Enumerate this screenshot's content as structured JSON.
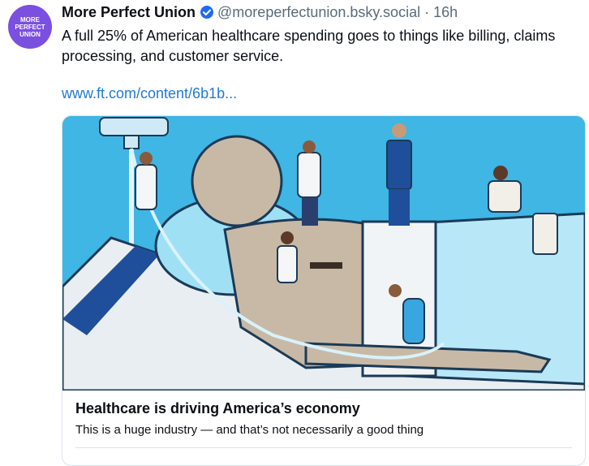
{
  "post": {
    "avatar_text": "MORE\nPERFECT\nUNION",
    "author_name": "More Perfect Union",
    "handle": "@moreperfectunion.bsky.social",
    "separator": "·",
    "time": "16h",
    "text": "A full 25% of American healthcare spending goes to things like billing, claims processing, and customer service.",
    "link_text": "www.ft.com/content/6b1b..."
  },
  "card": {
    "title": "Healthcare is driving America’s economy",
    "description": "This is a huge industry — and that’s not necessarily a good thing"
  },
  "colors": {
    "avatar_bg": "#7b4fe0",
    "link": "#1f7ad6",
    "verified": "#1d6cf0",
    "illustration_bg": "#3fb6e4"
  },
  "icons": {
    "verified": "verified-check-icon"
  }
}
